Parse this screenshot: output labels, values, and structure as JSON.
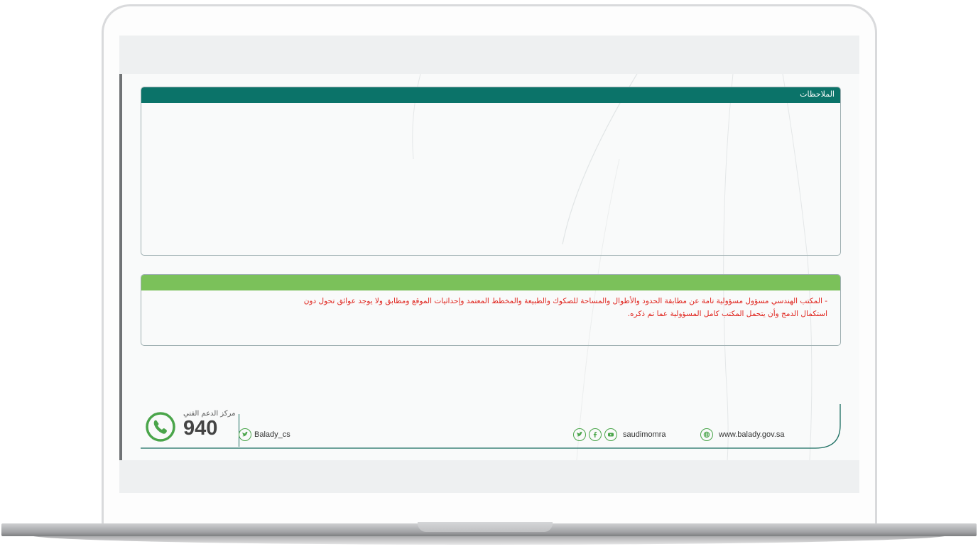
{
  "notes": {
    "header": "الملاحظات",
    "body": ""
  },
  "disclaimer": {
    "line1": "- المكتب الهندسي مسؤول مسؤولية تامة عن مطابقة الحدود والأطوال والمساحة للصكوك والطبيعة والمخطط المعتمد وإحداثيات الموقع ومطابق ولا يوجد عوائق تحول دون",
    "line2": "استكمال الدمج وأن يتحمل المكتب كامل المسؤولية عما تم ذكره."
  },
  "footer": {
    "support_label": "مركز الدعم الفني",
    "support_number": "940",
    "twitter_handle": "Balady_cs",
    "social_handle": "saudimomra",
    "website": "www.balady.gov.sa"
  },
  "colors": {
    "notes_header": "#0b7369",
    "disclaimer_header": "#7bc15a",
    "disclaimer_text": "#e0261f",
    "icon_green": "#4aa54a"
  }
}
